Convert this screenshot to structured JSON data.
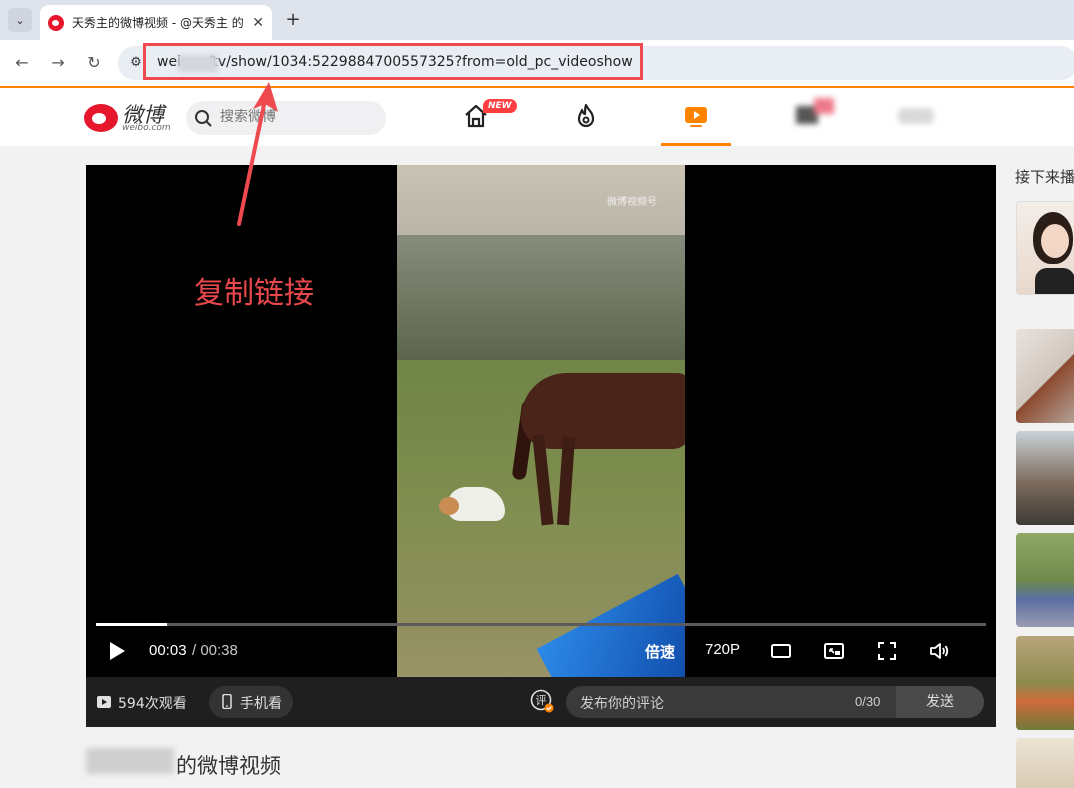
{
  "browser": {
    "tab_title": "天秀主的微博视频 - @天秀主 的",
    "tab_close": "✕",
    "new_tab": "+",
    "dropdown": "⌄",
    "url": "wei     om/tv/show/1034:5229884700557325?from=old_pc_videoshow",
    "nav": {
      "back": "←",
      "forward": "→",
      "reload": "↻",
      "site_info": "⚙"
    }
  },
  "header": {
    "logo_text": "微博",
    "logo_sub": "weibo.com",
    "search_placeholder": "搜索微博",
    "new_badge": "NEW",
    "accent_color": "#ff8200"
  },
  "player": {
    "watermark": "微博视频号",
    "time_current": "00:03",
    "time_total": "/ 00:38",
    "progress": 0.08,
    "speed_label": "倍速",
    "quality_label": "720P"
  },
  "player_bar": {
    "views": "594次观看",
    "mobile_label": "手机看",
    "comment_placeholder": "发布你的评论",
    "comment_count": "0/30",
    "send_label": "发送"
  },
  "annotation": {
    "text": "复制链接",
    "color": "#e8484c"
  },
  "page": {
    "video_title": "的微博视频"
  },
  "sidebar": {
    "heading": "接下来播"
  }
}
